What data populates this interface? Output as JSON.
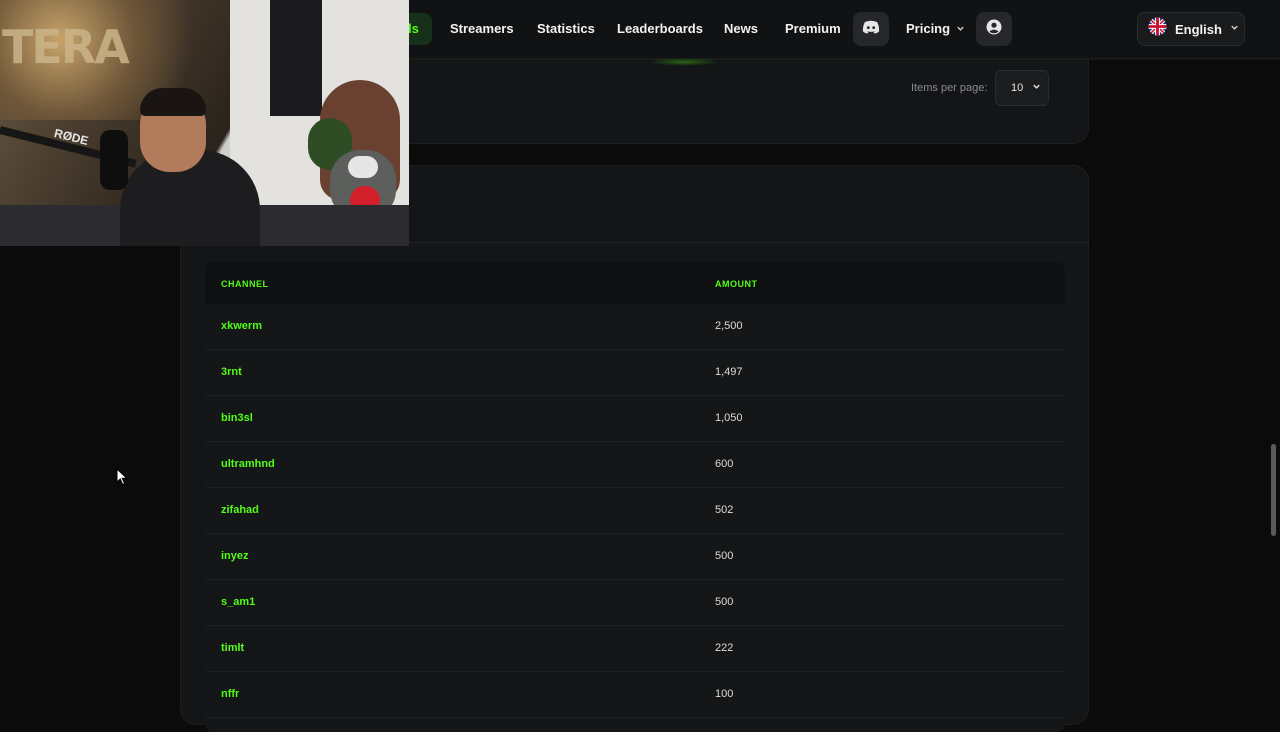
{
  "nav": {
    "active_tab_fragment": "ls",
    "items": [
      "Streamers",
      "Statistics",
      "Leaderboards",
      "News",
      "Premium"
    ],
    "pricing_label": "Pricing",
    "language_label": "English"
  },
  "pagination": {
    "items_per_page_label": "Items per page:",
    "items_per_page_value": "10"
  },
  "table": {
    "columns": [
      "CHANNEL",
      "AMOUNT"
    ],
    "rows": [
      {
        "channel": "xkwerm",
        "amount": "2,500"
      },
      {
        "channel": "3rnt",
        "amount": "1,497"
      },
      {
        "channel": "bin3sl",
        "amount": "1,050"
      },
      {
        "channel": "ultramhnd",
        "amount": "600"
      },
      {
        "channel": "zifahad",
        "amount": "502"
      },
      {
        "channel": "inyez",
        "amount": "500"
      },
      {
        "channel": "s_am1",
        "amount": "500"
      },
      {
        "channel": "timlt",
        "amount": "222"
      },
      {
        "channel": "nffr",
        "amount": "100"
      }
    ]
  },
  "webcam": {
    "wall_text": "TERA",
    "mic_brand": "RØDE"
  },
  "colors": {
    "accent": "#53fc18",
    "background": "#0b0b0c",
    "card": "#141516"
  }
}
